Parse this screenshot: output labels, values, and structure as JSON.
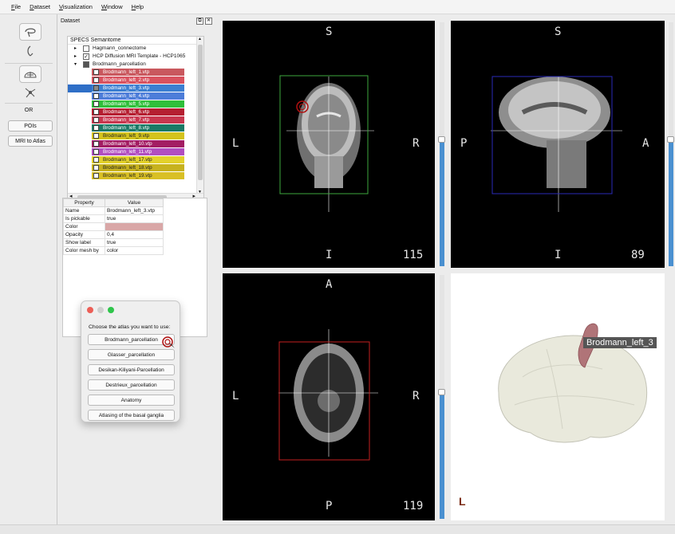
{
  "menu": [
    "File",
    "Dataset",
    "Visualization",
    "Window",
    "Help"
  ],
  "sidebar": {
    "or_label": "OR",
    "pois_button": "POIs",
    "mri_button": "MRI to Atlas"
  },
  "dataset": {
    "title": "Dataset",
    "title_icons": [
      "⧉",
      "✕"
    ],
    "tree_title": "SPECS Semantome",
    "collapse_arrow": "▸",
    "expand_arrow": "▾",
    "checkmark": "✓",
    "scroll_up": "▲",
    "scroll_down": "▼",
    "scroll_left": "◂",
    "scroll_right": "▸",
    "nodes": [
      {
        "label": "Hagmann_connectome"
      },
      {
        "label": "HCP Diffusion MRI Template - HCP1065"
      },
      {
        "label": "Brodmann_parcellation"
      }
    ],
    "leaves": [
      {
        "label": "Brodmann_left_1.vtp",
        "color": "#c9585e"
      },
      {
        "label": "Brodmann_left_2.vtp",
        "color": "#d9525f"
      },
      {
        "label": "Brodmann_left_3.vtp",
        "color": "#3c7fd1"
      },
      {
        "label": "Brodmann_left_4.vtp",
        "color": "#4d7dd9"
      },
      {
        "label": "Brodmann_left_5.vtp",
        "color": "#2fbf3a"
      },
      {
        "label": "Brodmann_left_6.vtp",
        "color": "#b51f31"
      },
      {
        "label": "Brodmann_left_7.vtp",
        "color": "#c9374f"
      },
      {
        "label": "Brodmann_left_8.vtp",
        "color": "#1a7a66"
      },
      {
        "label": "Brodmann_left_9.vtp",
        "color": "#d4c31d"
      },
      {
        "label": "Brodmann_left_10.vtp",
        "color": "#a31d63"
      },
      {
        "label": "Brodmann_left_11.vtp",
        "color": "#b14ec0"
      },
      {
        "label": "Brodmann_left_17.vtp",
        "color": "#e3d12b"
      },
      {
        "label": "Brodmann_left_18.vtp",
        "color": "#c7b21e"
      },
      {
        "label": "Brodmann_left_19.vtp",
        "color": "#d9c025"
      }
    ]
  },
  "properties": {
    "headers": [
      "Property",
      "Value"
    ],
    "rows": [
      {
        "property": "Name",
        "value": "Brodmann_left_3.vtp"
      },
      {
        "property": "Is pickable",
        "value": "true"
      },
      {
        "property": "Color",
        "value": ""
      },
      {
        "property": "Opacity",
        "value": "0,4"
      },
      {
        "property": "Show label",
        "value": "true"
      },
      {
        "property": "Color mesh by",
        "value": "color"
      }
    ],
    "color_swatch": "#d9a7a7"
  },
  "atlas_dialog": {
    "prompt": "Choose the atlas you want to use:",
    "options": [
      "Brodmann_parcellation",
      "Glasser_parcellation",
      "Desikan-Kiliyani-Parcellation",
      "Destrieux_parcellation",
      "Anatomy",
      "Atlasing of the basal ganglia"
    ]
  },
  "views": {
    "coronal": {
      "top": "S",
      "left": "L",
      "right": "R",
      "bottom": "I",
      "slice": "115",
      "box_color": "#3ea83e",
      "slider_level": 0.52
    },
    "sagittal": {
      "top": "S",
      "left": "P",
      "right": "A",
      "bottom": "I",
      "slice": "89",
      "box_color": "#2a2ab8",
      "slider_level": 0.52
    },
    "axial": {
      "top": "A",
      "left": "L",
      "right": "R",
      "bottom": "P",
      "slice": "119",
      "box_color": "#c42020",
      "slider_level": 0.52
    },
    "model3d": {
      "label": "Brodmann_left_3",
      "orientation": "L"
    }
  }
}
